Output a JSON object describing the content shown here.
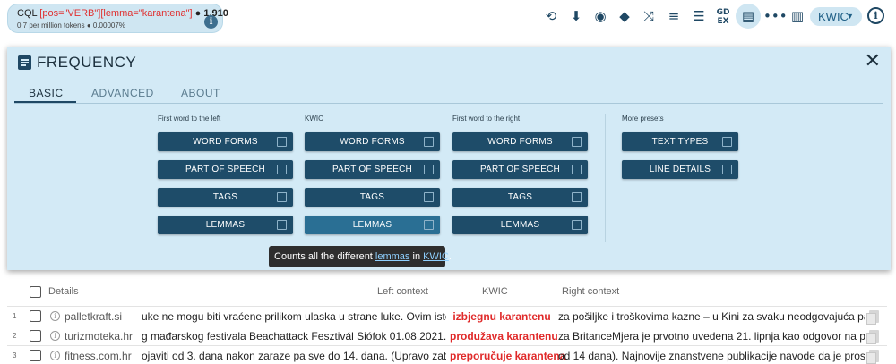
{
  "query": {
    "cql_label": "CQL",
    "query_text": "[pos=\"VERB\"][lemma=\"karantena\"]",
    "hits_text": "● 1,910",
    "stats_text": "0.7 per million tokens ● 0.00007%"
  },
  "toolbar": {
    "view_label": "KWIC",
    "icons": [
      "search-replace-icon",
      "download-icon",
      "eye-icon",
      "tag-icon",
      "shuffle-icon",
      "sort-icon",
      "filter-icon",
      "gdex-icon",
      "frequency-icon",
      "collocations-icon",
      "chart-icon",
      "help-icon"
    ]
  },
  "panel": {
    "title": "FREQUENCY",
    "tabs": [
      "BASIC",
      "ADVANCED",
      "ABOUT"
    ],
    "active_tab": "BASIC",
    "columns": [
      {
        "label": "First word to the left",
        "buttons": [
          "WORD FORMS",
          "PART OF SPEECH",
          "TAGS",
          "LEMMAS"
        ]
      },
      {
        "label": "KWIC",
        "buttons": [
          "WORD FORMS",
          "PART OF SPEECH",
          "TAGS",
          "LEMMAS"
        ]
      },
      {
        "label": "First word to the right",
        "buttons": [
          "WORD FORMS",
          "PART OF SPEECH",
          "TAGS",
          "LEMMAS"
        ]
      },
      {
        "label": "More presets",
        "buttons": [
          "TEXT TYPES",
          "LINE DETAILS"
        ]
      }
    ]
  },
  "tooltip": {
    "prefix": "Counts all the different ",
    "link1": "lemmas",
    "middle": " in ",
    "link2": "KWIC",
    "suffix": "."
  },
  "results": {
    "headers": {
      "details": "Details",
      "left": "Left context",
      "kwic": "KWIC",
      "right": "Right context"
    },
    "rows": [
      {
        "num": "1",
        "source": "palletkraft.si",
        "left": "uke ne mogu biti vraćene prilikom ulaska u strane luke. Ovim isto tako",
        "kwic": "izbjegnu karantenu",
        "right": "za pošiljke i troškovima kazne – u Kini za svaku neodgovajuća palet"
      },
      {
        "num": "2",
        "source": "turizmoteka.hr",
        "left": "g mađarskog festivala Beachattack Fesztivál Siófok 01.08.2021.Italija",
        "kwic": "produžava karantenu",
        "right": "za BritanceMjera je prvotno uvedena 21. lipnja kao odgovor na pojavu"
      },
      {
        "num": "3",
        "source": "fitness.com.hr",
        "left": "ojaviti od 3. dana nakon zaraze pa sve do 14. dana. (Upravo zato se i",
        "kwic": "preporučuje karantena",
        "right": "od 14 dana). Najnovije znanstvene publikacije navode da je prosječno"
      }
    ]
  }
}
